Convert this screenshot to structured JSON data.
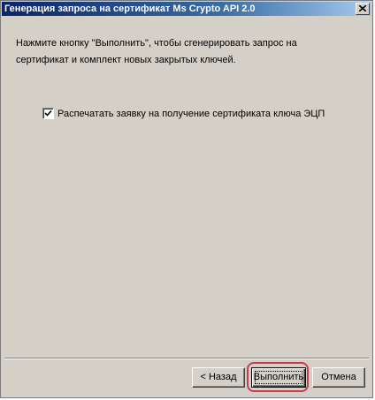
{
  "window": {
    "title": "Генерация запроса на сертификат Ms Crypto API 2.0"
  },
  "body": {
    "line1": "Нажмите кнопку \"Выполнить\", чтобы сгенерировать запрос на",
    "line2": "сертификат и комплект новых закрытых ключей."
  },
  "checkbox": {
    "label": "Распечатать заявку на получение сертификата ключа ЭЦП",
    "checked": true
  },
  "buttons": {
    "back_label": "< Назад",
    "execute_label": "Выполнить",
    "cancel_label": "Отмена"
  },
  "colors": {
    "titlebar_start": "#0a246a",
    "dialog_background": "#d4d0c8",
    "highlight": "#c83c50"
  }
}
